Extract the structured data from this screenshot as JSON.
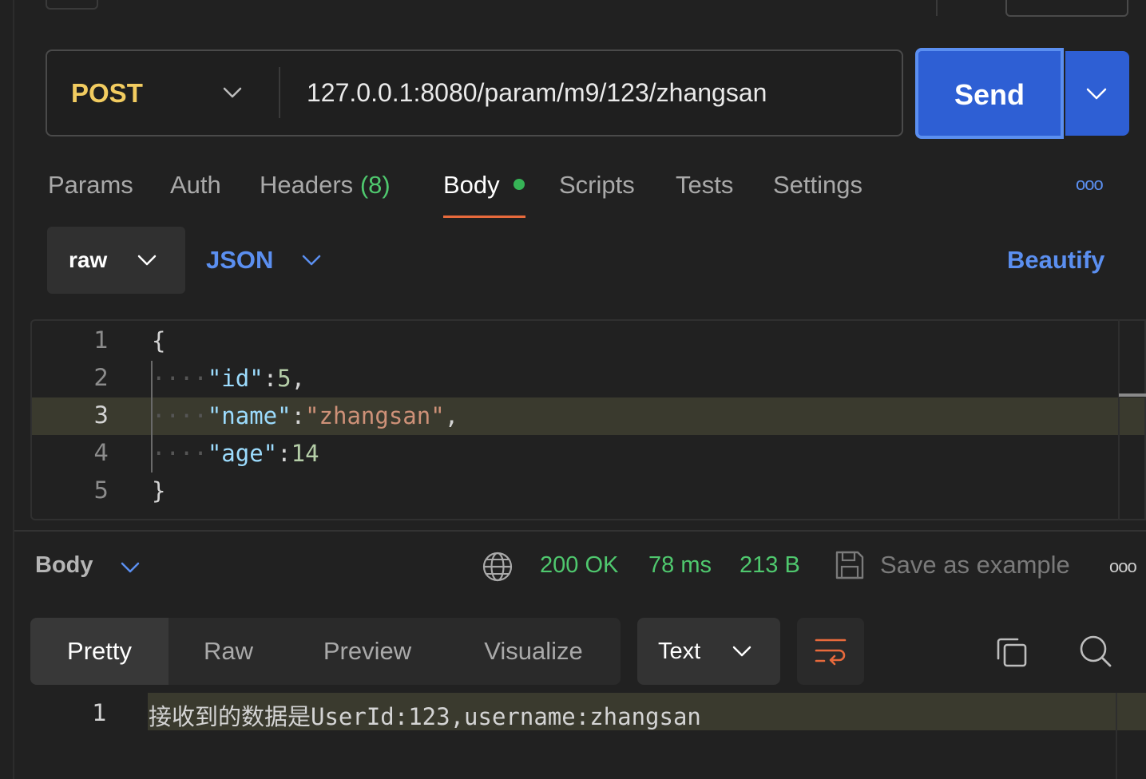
{
  "request": {
    "method": "POST",
    "url": "127.0.0.1:8080/param/m9/123/zhangsan",
    "send_label": "Send"
  },
  "tabs": [
    {
      "label": "Params"
    },
    {
      "label": "Auth"
    },
    {
      "label": "Headers",
      "count": "(8)"
    },
    {
      "label": "Body",
      "active": true
    },
    {
      "label": "Scripts"
    },
    {
      "label": "Tests"
    },
    {
      "label": "Settings"
    }
  ],
  "more_label": "ooo",
  "body_options": {
    "mode": "raw",
    "language": "JSON",
    "beautify_label": "Beautify"
  },
  "editor": {
    "lines": [
      "1",
      "2",
      "3",
      "4",
      "5"
    ],
    "active_line": 3
  },
  "response": {
    "section_label": "Body",
    "status": "200 OK",
    "time": "78 ms",
    "size": "213 B",
    "save_label": "Save as example",
    "view_tabs": [
      "Pretty",
      "Raw",
      "Preview",
      "Visualize"
    ],
    "format": "Text",
    "line_number": "1",
    "content": "接收到的数据是UserId:123,username:zhangsan"
  },
  "colors": {
    "accent_blue": "#2e5fd4",
    "method_yellow": "#f2cc60",
    "status_green": "#4fc86e",
    "active_tab_underline": "#e86a3c"
  },
  "icons": [
    "chevron-down-icon",
    "globe-icon",
    "save-icon",
    "wrap-lines-icon",
    "copy-icon",
    "search-icon"
  ]
}
